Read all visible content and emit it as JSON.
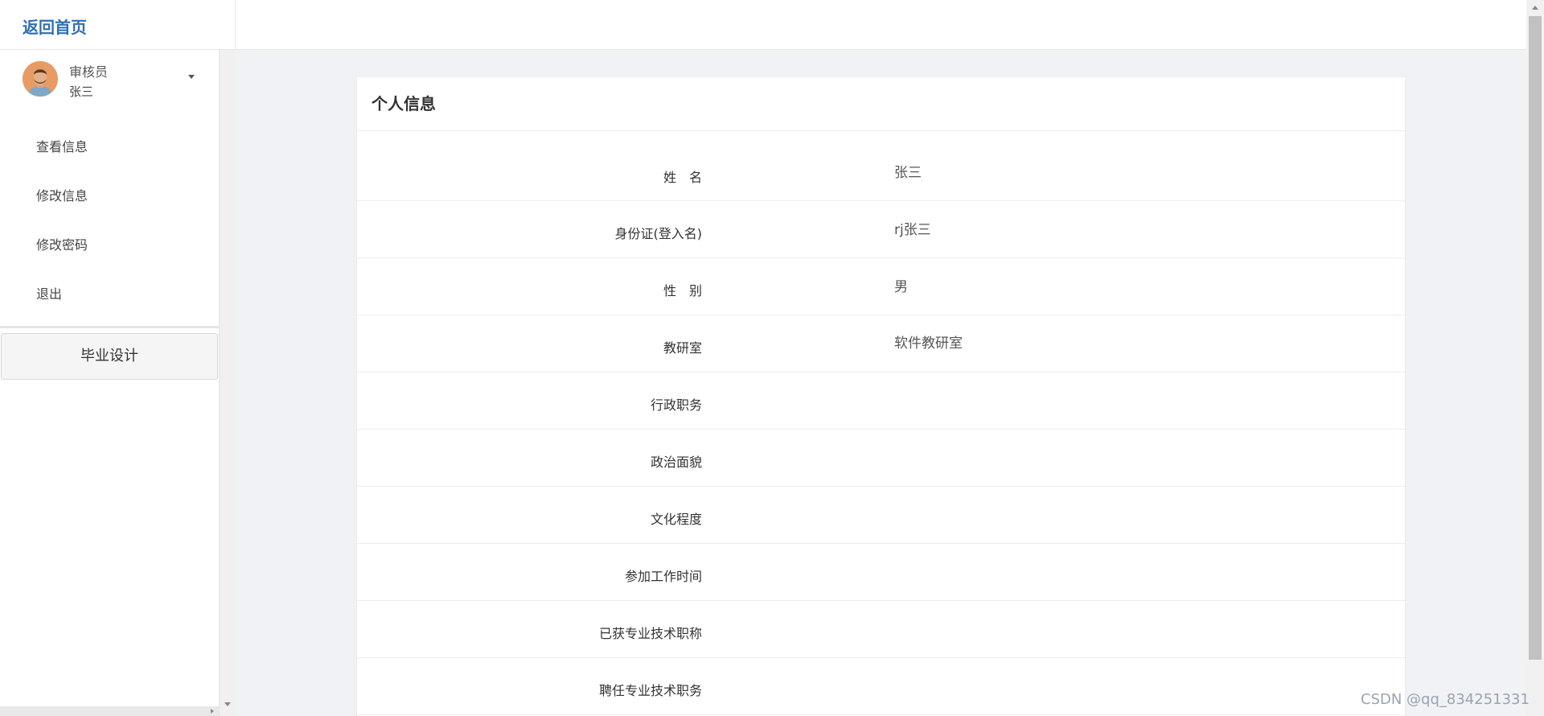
{
  "header": {
    "home_link": "返回首页"
  },
  "sidebar": {
    "user": {
      "role": "审核员",
      "name": "张三"
    },
    "menu": [
      {
        "label": "查看信息"
      },
      {
        "label": "修改信息"
      },
      {
        "label": "修改密码"
      },
      {
        "label": "退出"
      }
    ],
    "module_button": "毕业设计"
  },
  "card": {
    "title": "个人信息",
    "rows": [
      {
        "label": "姓　名",
        "value": "张三"
      },
      {
        "label": "身份证(登入名)",
        "value": "rj张三"
      },
      {
        "label": "性　别",
        "value": "男"
      },
      {
        "label": "教研室",
        "value": "软件教研室"
      },
      {
        "label": "行政职务",
        "value": ""
      },
      {
        "label": "政治面貌",
        "value": ""
      },
      {
        "label": "文化程度",
        "value": ""
      },
      {
        "label": "参加工作时间",
        "value": ""
      },
      {
        "label": "已获专业技术职称",
        "value": ""
      },
      {
        "label": "聘任专业技术职务",
        "value": ""
      }
    ]
  },
  "watermark": "CSDN @qq_834251331",
  "colors": {
    "brand": "#2f6fb3",
    "avatar_bg": "#e89b63"
  }
}
